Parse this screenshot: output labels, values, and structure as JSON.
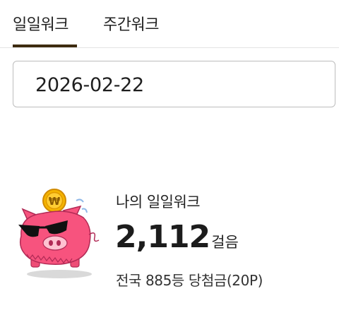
{
  "tabs": [
    {
      "label": "일일워크",
      "active": true
    },
    {
      "label": "주간워크",
      "active": false
    }
  ],
  "accent_color": "#3d2b0f",
  "date_field": {
    "value": "2026-02-22"
  },
  "summary": {
    "label": "나의 일일워크",
    "steps": "2,112",
    "steps_unit": "걸음",
    "rank_text": "전국 885등 당첨금(20P)"
  },
  "mascot": {
    "icon": "piggy-bank-coin-icon",
    "coin_symbol": "₩",
    "body_color": "#f7537e"
  }
}
